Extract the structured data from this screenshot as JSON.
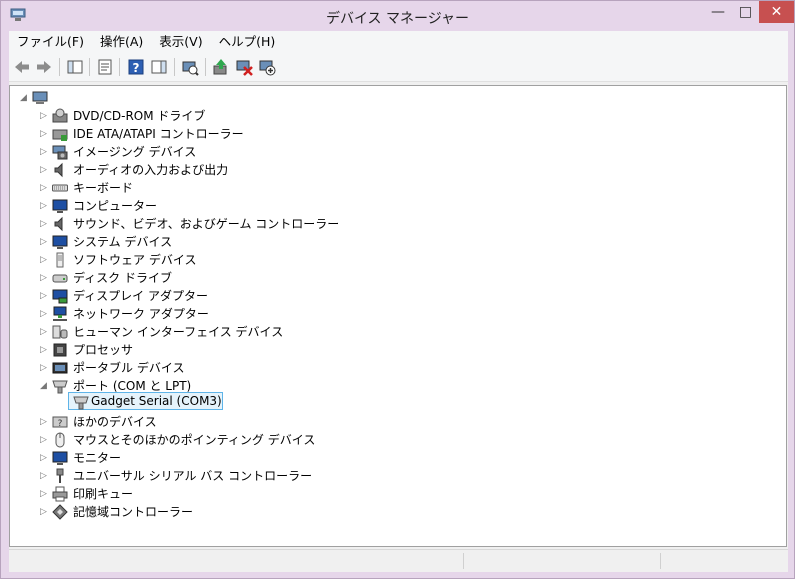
{
  "window": {
    "title": "デバイス マネージャー",
    "min_glyph": "—",
    "max_glyph": "□",
    "close_glyph": "✕"
  },
  "menu": [
    {
      "label": "ファイル(F)"
    },
    {
      "label": "操作(A)"
    },
    {
      "label": "表示(V)"
    },
    {
      "label": "ヘルプ(H)"
    }
  ],
  "toolbar": [
    {
      "name": "back-button",
      "icon": "arrow-left-icon"
    },
    {
      "name": "forward-button",
      "icon": "arrow-right-icon"
    },
    {
      "name": "show-hide-console-tree-button",
      "icon": "console-tree-icon"
    },
    {
      "name": "properties-button",
      "icon": "properties-icon"
    },
    {
      "name": "help-button",
      "icon": "help-icon"
    },
    {
      "name": "action-pane-button",
      "icon": "action-pane-icon"
    },
    {
      "name": "scan-hardware-button",
      "icon": "scan-hardware-icon"
    },
    {
      "name": "update-driver-button",
      "icon": "update-driver-icon"
    },
    {
      "name": "uninstall-button",
      "icon": "uninstall-icon"
    },
    {
      "name": "add-legacy-hardware-button",
      "icon": "add-hardware-icon"
    }
  ],
  "tree": {
    "root": {
      "label": "",
      "expanded": true,
      "icon": "computer-icon"
    },
    "items": [
      {
        "label": "DVD/CD-ROM ドライブ",
        "icon": "dvd-drive-icon",
        "expanded": false
      },
      {
        "label": "IDE ATA/ATAPI コントローラー",
        "icon": "ide-controller-icon",
        "expanded": false
      },
      {
        "label": "イメージング デバイス",
        "icon": "camera-icon",
        "expanded": false
      },
      {
        "label": "オーディオの入力および出力",
        "icon": "speaker-icon",
        "expanded": false
      },
      {
        "label": "キーボード",
        "icon": "keyboard-icon",
        "expanded": false
      },
      {
        "label": "コンピューター",
        "icon": "monitor-icon",
        "expanded": false
      },
      {
        "label": "サウンド、ビデオ、およびゲーム コントローラー",
        "icon": "speaker-icon",
        "expanded": false
      },
      {
        "label": "システム デバイス",
        "icon": "monitor-icon",
        "expanded": false
      },
      {
        "label": "ソフトウェア デバイス",
        "icon": "software-device-icon",
        "expanded": false
      },
      {
        "label": "ディスク ドライブ",
        "icon": "disk-drive-icon",
        "expanded": false
      },
      {
        "label": "ディスプレイ アダプター",
        "icon": "display-adapter-icon",
        "expanded": false
      },
      {
        "label": "ネットワーク アダプター",
        "icon": "network-adapter-icon",
        "expanded": false
      },
      {
        "label": "ヒューマン インターフェイス デバイス",
        "icon": "hid-icon",
        "expanded": false
      },
      {
        "label": "プロセッサ",
        "icon": "processor-icon",
        "expanded": false
      },
      {
        "label": "ポータブル デバイス",
        "icon": "portable-device-icon",
        "expanded": false
      },
      {
        "label": "ポート (COM と LPT)",
        "icon": "port-icon",
        "expanded": true,
        "children": [
          {
            "label": "Gadget Serial (COM3)",
            "icon": "port-icon",
            "selected": true
          }
        ]
      },
      {
        "label": "ほかのデバイス",
        "icon": "unknown-device-icon",
        "expanded": false
      },
      {
        "label": "マウスとそのほかのポインティング デバイス",
        "icon": "mouse-icon",
        "expanded": false
      },
      {
        "label": "モニター",
        "icon": "monitor-icon",
        "expanded": false
      },
      {
        "label": "ユニバーサル シリアル バス コントローラー",
        "icon": "usb-icon",
        "expanded": false
      },
      {
        "label": "印刷キュー",
        "icon": "printer-icon",
        "expanded": false
      },
      {
        "label": "記憶域コントローラー",
        "icon": "storage-controller-icon",
        "expanded": false
      }
    ]
  }
}
